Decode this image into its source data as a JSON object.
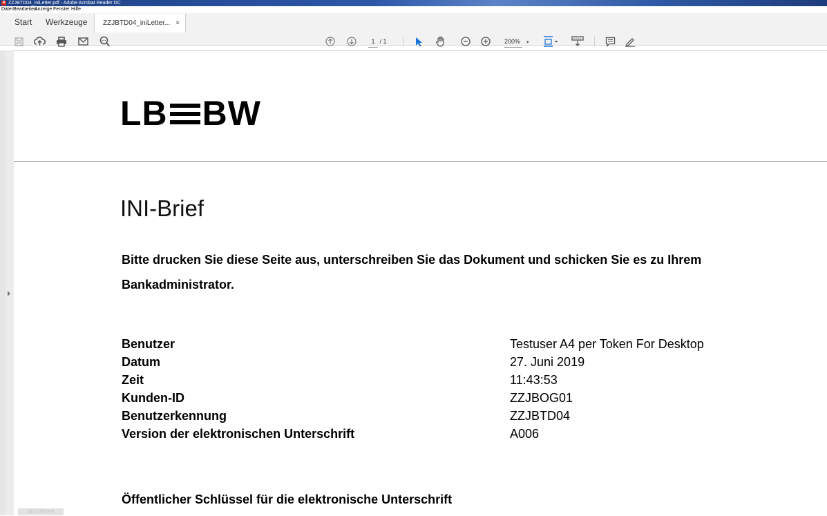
{
  "window": {
    "title": "ZZJBTD04_iniLetter.pdf - Adobe Acrobat Reader DC"
  },
  "menu": [
    "Datei",
    "Bearbeiten",
    "Anzeige",
    "Fenster",
    "Hilfe"
  ],
  "tabs": {
    "start": "Start",
    "tools": "Werkzeuge",
    "document": "ZZJBTD04_iniLetter...",
    "close": "×"
  },
  "toolbar": {
    "page_current": "1",
    "page_total": "/ 1",
    "zoom": "200%"
  },
  "document": {
    "logo": {
      "left": "LB",
      "right": "BW"
    },
    "title": "INI-Brief",
    "intro": "Bitte drucken Sie diese Seite aus, unterschreiben Sie das Dokument und schicken Sie es zu Ihrem Bankadministrator.",
    "fields": [
      {
        "label": "Benutzer",
        "value": "Testuser A4 per Token For Desktop"
      },
      {
        "label": "Datum",
        "value": "27. Juni 2019"
      },
      {
        "label": "Zeit",
        "value": "11:43:53"
      },
      {
        "label": "Kunden-ID",
        "value": "ZZJBOG01"
      },
      {
        "label": "Benutzerkennung",
        "value": "ZZJBTD04"
      },
      {
        "label": "Version der elektronischen Unterschrift",
        "value": "A006"
      }
    ],
    "public_key_heading": "Öffentlicher Schlüssel für die elektronische Unterschrift"
  },
  "status": {
    "page_size": "210 x 297 mm"
  },
  "colors": {
    "accent": "#1a73d9",
    "titlebar": "#2c57a8"
  }
}
